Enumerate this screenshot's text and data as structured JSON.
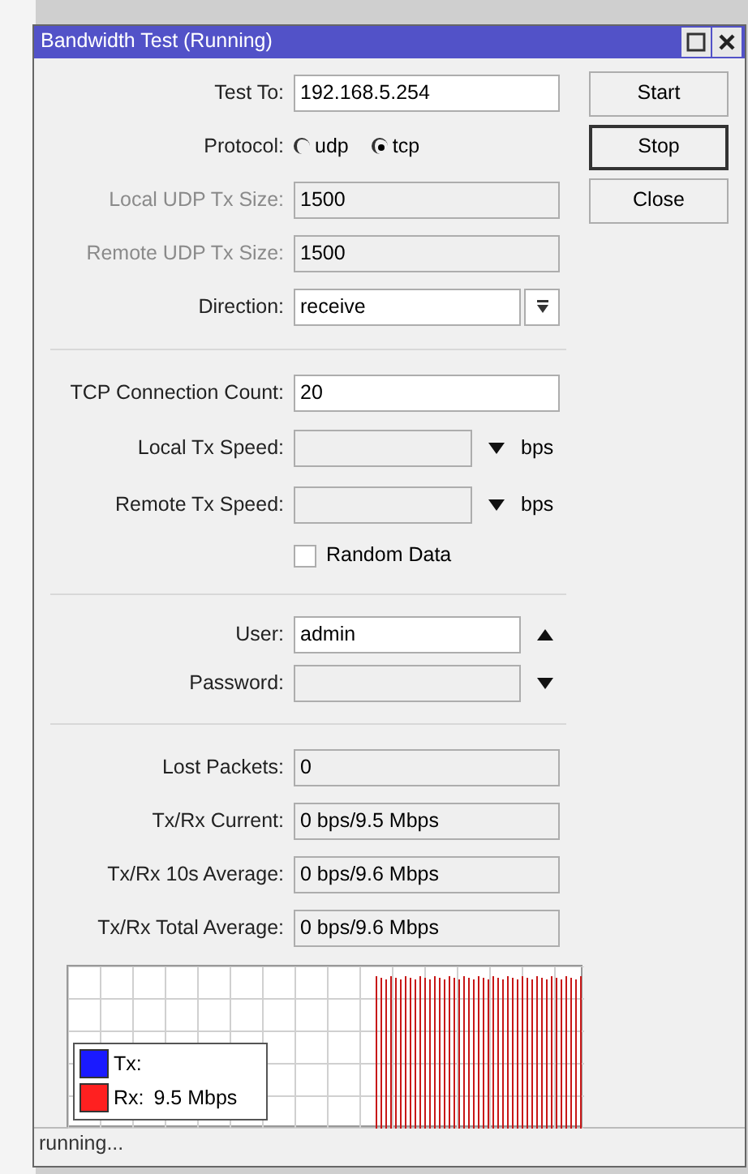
{
  "window": {
    "title": "Bandwidth Test (Running)"
  },
  "fields": [
    {
      "kind": "text",
      "label": "Test To:",
      "value": "192.168.5.254",
      "disabled": false
    },
    {
      "kind": "radio",
      "label": "Protocol:",
      "options": [
        {
          "label": "udp",
          "selected": false
        },
        {
          "label": "tcp",
          "selected": true
        }
      ]
    },
    {
      "kind": "text",
      "label": "Local UDP Tx Size:",
      "value": "1500",
      "disabled": true
    },
    {
      "kind": "text",
      "label": "Remote UDP Tx Size:",
      "value": "1500",
      "disabled": true
    },
    {
      "kind": "select",
      "label": "Direction:",
      "value": "receive"
    },
    {
      "kind": "separator"
    },
    {
      "kind": "text",
      "label": "TCP Connection Count:",
      "value": "20",
      "disabled": false
    },
    {
      "kind": "speed",
      "label": "Local Tx Speed:",
      "unit": "bps"
    },
    {
      "kind": "speed",
      "label": "Remote Tx Speed:",
      "unit": "bps"
    },
    {
      "kind": "checkbox",
      "label": "Random Data",
      "checked": false
    },
    {
      "kind": "separator"
    },
    {
      "kind": "toggle",
      "label": "User:",
      "value": "admin",
      "expanded": true,
      "disabled": false
    },
    {
      "kind": "toggle",
      "label": "Password:",
      "expanded": false,
      "disabled": true
    },
    {
      "kind": "separator"
    },
    {
      "kind": "readonly",
      "label": "Lost Packets:",
      "value": "0"
    },
    {
      "kind": "readonly",
      "label": "Tx/Rx Current:",
      "value": "0 bps/9.5 Mbps"
    },
    {
      "kind": "readonly",
      "label": "Tx/Rx 10s Average:",
      "value": "0 bps/9.6 Mbps"
    },
    {
      "kind": "readonly",
      "label": "Tx/Rx Total Average:",
      "value": "0 bps/9.6 Mbps"
    }
  ],
  "buttons": [
    {
      "label": "Start",
      "selected": false
    },
    {
      "label": "Stop",
      "selected": true
    },
    {
      "label": "Close",
      "selected": false
    }
  ],
  "graph": {
    "legend": [
      {
        "label": "Tx:",
        "color": "#1a1aff"
      },
      {
        "label": "Rx:",
        "value": "9.5 Mbps",
        "color": "#ff2020"
      }
    ]
  },
  "status_bar": "running..."
}
